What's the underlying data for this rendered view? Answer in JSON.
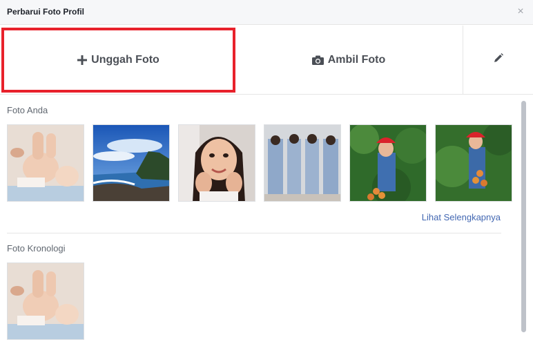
{
  "dialog": {
    "title": "Perbarui Foto Profil",
    "close_symbol": "×"
  },
  "actions": {
    "upload_label": "Unggah Foto",
    "take_label": "Ambil Foto",
    "upload_icon": "plus-icon",
    "take_icon": "camera-icon",
    "edit_icon": "pencil-icon"
  },
  "your_photos": {
    "label": "Foto Anda",
    "see_more": "Lihat Selengkapnya",
    "items": [
      "baby photo",
      "sea and sky photo",
      "selfie photo",
      "mirrored collage photo",
      "tree photo with red hat",
      "tree photo with red hat"
    ]
  },
  "timeline_photos": {
    "label": "Foto Kronologi",
    "items": [
      "baby photo"
    ]
  },
  "colors": {
    "highlight_border": "#e8212b",
    "link": "#4267b2",
    "header_bg": "#f6f7f9"
  }
}
